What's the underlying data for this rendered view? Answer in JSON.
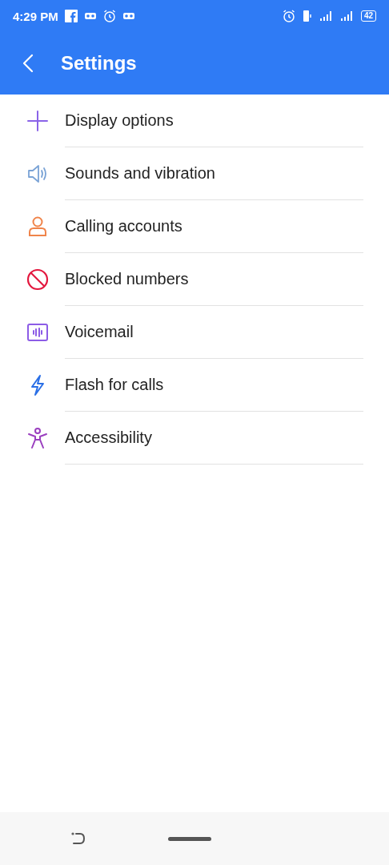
{
  "status_bar": {
    "time": "4:29 PM",
    "battery": "42"
  },
  "header": {
    "title": "Settings"
  },
  "items": [
    {
      "label": "Display options",
      "kind": "plus",
      "color": "#8a63e8"
    },
    {
      "label": "Sounds and vibration",
      "kind": "speaker",
      "color": "#7aa3d6"
    },
    {
      "label": "Calling accounts",
      "kind": "person",
      "color": "#f0844a"
    },
    {
      "label": "Blocked numbers",
      "kind": "blocked",
      "color": "#e3173e"
    },
    {
      "label": "Voicemail",
      "kind": "voicemail",
      "color": "#8c5ce6"
    },
    {
      "label": "Flash for calls",
      "kind": "flash",
      "color": "#2a6fe6"
    },
    {
      "label": "Accessibility",
      "kind": "accessibility",
      "color": "#9a3fbf"
    }
  ]
}
